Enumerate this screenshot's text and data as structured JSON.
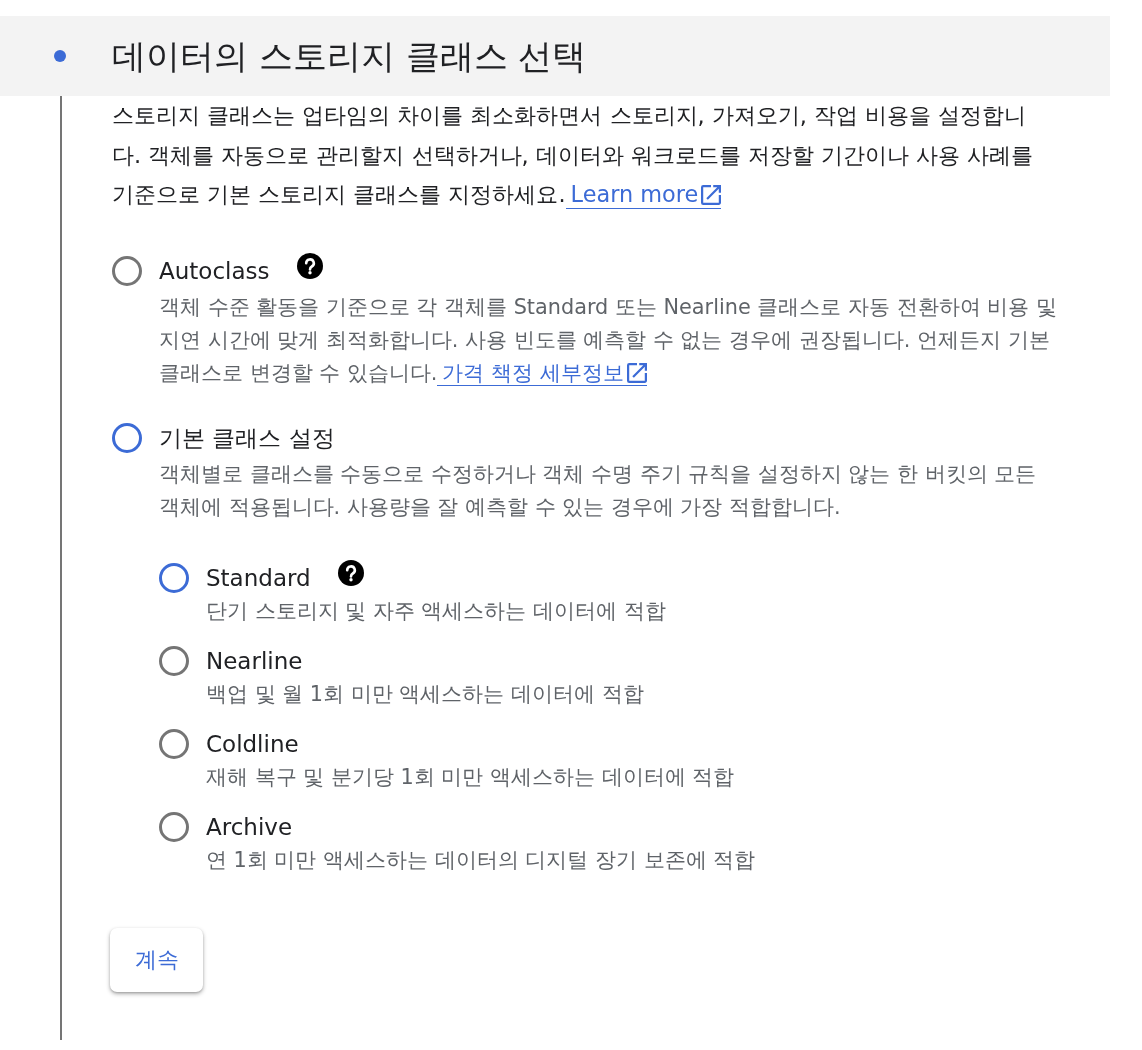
{
  "header": {
    "title": "데이터의 스토리지 클래스 선택"
  },
  "intro": {
    "text": "스토리지 클래스는 업타임의 차이를 최소화하면서 스토리지, 가져오기, 작업 비용을 설정합니다. 객체를 자동으로 관리할지 선택하거나, 데이터와 워크로드를 저장할 기간이나 사용 사례를 기준으로 기본 스토리지 클래스를 지정하세요.",
    "link": "Learn more"
  },
  "modes": [
    {
      "label": "Autoclass",
      "help": true,
      "selected": false,
      "description": "객체 수준 활동을 기준으로 각 객체를 Standard 또는 Nearline 클래스로 자동 전환하여 비용 및 지연 시간에 맞게 최적화합니다. 사용 빈도를 예측할 수 없는 경우에 권장됩니다. 언제든지 기본 클래스로 변경할 수 있습니다.",
      "link": "가격 책정 세부정보"
    },
    {
      "label": "기본 클래스 설정",
      "help": false,
      "selected": true,
      "description": "객체별로 클래스를 수동으로 수정하거나 객체 수명 주기 규칙을 설정하지 않는 한 버킷의 모든 객체에 적용됩니다. 사용량을 잘 예측할 수 있는 경우에 가장 적합합니다.",
      "classes": [
        {
          "label": "Standard",
          "help": true,
          "selected": true,
          "description": "단기 스토리지 및 자주 액세스하는 데이터에 적합"
        },
        {
          "label": "Nearline",
          "help": false,
          "selected": false,
          "description": "백업 및 월 1회 미만 액세스하는 데이터에 적합"
        },
        {
          "label": "Coldline",
          "help": false,
          "selected": false,
          "description": "재해 복구 및 분기당 1회 미만 액세스하는 데이터에 적합"
        },
        {
          "label": "Archive",
          "help": false,
          "selected": false,
          "description": "연 1회 미만 액세스하는 데이터의 디지털 장기 보존에 적합"
        }
      ]
    }
  ],
  "continue_button": "계속"
}
